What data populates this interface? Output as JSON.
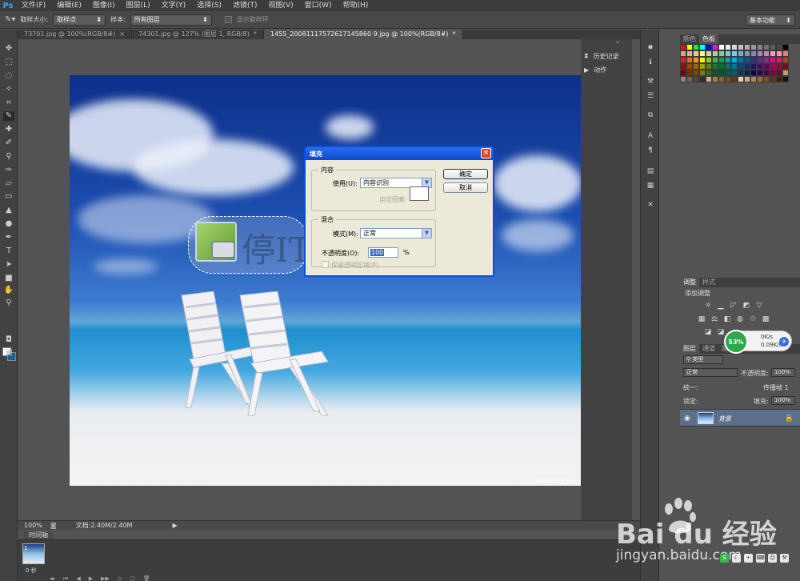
{
  "app": {
    "logo": "Ps"
  },
  "menu": [
    "文件(F)",
    "编辑(E)",
    "图像(I)",
    "图层(L)",
    "文字(Y)",
    "选择(S)",
    "滤镜(T)",
    "视图(V)",
    "窗口(W)",
    "帮助(H)"
  ],
  "options": {
    "sample_size_label": "取样大小:",
    "sample_size_value": "取样点",
    "sample_label": "样本:",
    "sample_value": "所有图层",
    "show_ring_label": "显示取样环",
    "workspace": "基本功能"
  },
  "doc_tabs": [
    {
      "label": "73701.jpg @ 100%(RGB/8#)",
      "close": "×",
      "active": false
    },
    {
      "label": "74301.jpg @ 127% (图层 1, RGB/8)",
      "close": "*",
      "active": false
    },
    {
      "label": "1455_20081117572617145860 9.jpg @ 100%(RGB/8#)",
      "close": "*",
      "active": true
    }
  ],
  "canvas": {
    "watermark_text": "停ITI",
    "credit": "www.fevte.com"
  },
  "status": {
    "zoom": "100%",
    "doc_size": "文档:2.40M/2.40M"
  },
  "timeline": {
    "tab": "时间轴",
    "frame_number": "1",
    "frame_time": "0 秒"
  },
  "history_panel": [
    {
      "icon": "history-icon",
      "label": "历史记录"
    },
    {
      "icon": "actions-icon",
      "label": "动作"
    }
  ],
  "color_panel": {
    "tabs": [
      "颜色",
      "色板"
    ],
    "active": 1
  },
  "swatch_colors": [
    "#ff0000",
    "#ffff00",
    "#00ff00",
    "#00ffff",
    "#0000ff",
    "#ff00ff",
    "#ffffff",
    "#ebebeb",
    "#d6d6d6",
    "#c2c2c2",
    "#adadad",
    "#999999",
    "#858585",
    "#707070",
    "#5c5c5c",
    "#474747",
    "#000000",
    "#f7977a",
    "#f9ad81",
    "#fdc68a",
    "#fff79a",
    "#c4df9b",
    "#a3d39c",
    "#82ca9d",
    "#7bcdc8",
    "#6ecff6",
    "#7ea7d8",
    "#8493ca",
    "#8882be",
    "#a187be",
    "#bc8dbf",
    "#f49ac2",
    "#f6989d",
    "#ff7777",
    "#ed1c24",
    "#f26522",
    "#f7941d",
    "#fff200",
    "#8dc63f",
    "#39b54a",
    "#00a651",
    "#00a99d",
    "#00aeef",
    "#0072bc",
    "#0054a6",
    "#2e3192",
    "#662d91",
    "#92278f",
    "#ec008c",
    "#ed145b",
    "#c0392b",
    "#9e0b0f",
    "#a0410d",
    "#a36209",
    "#aba000",
    "#598527",
    "#197b30",
    "#007236",
    "#00746b",
    "#0076a3",
    "#004a80",
    "#003471",
    "#1b1464",
    "#440e62",
    "#630460",
    "#9e005d",
    "#9e0039",
    "#7a0026",
    "#790000",
    "#7b2e00",
    "#7d4900",
    "#827b00",
    "#406618",
    "#005e20",
    "#005826",
    "#005952",
    "#005b7f",
    "#003663",
    "#002157",
    "#0d004c",
    "#32004b",
    "#4b0049",
    "#7b0046",
    "#7a0026",
    "#c69c6d",
    "#998675",
    "#736357",
    "#534741",
    "#362f2d",
    "#c7b299",
    "#a67c52",
    "#8c6239",
    "#754c24",
    "#603913",
    "#e8d2b1",
    "#d0ad7f",
    "#b8864a",
    "#9c6e3b",
    "#7a5128",
    "#593816",
    "#3a2208",
    "#1e1004"
  ],
  "adjust_panel": {
    "tabs": [
      "调整",
      "样式"
    ],
    "add_label": "添加调整"
  },
  "layers_panel": {
    "tabs": [
      "图层",
      "通道",
      "路径"
    ],
    "kind_label": "类型",
    "blend_mode": "正常",
    "opacity_label": "不透明度:",
    "opacity_value": "100%",
    "unify_label": "统一:",
    "propagate_label": "传播帧 1",
    "lock_label": "锁定:",
    "fill_label": "填充:",
    "fill_value": "100%",
    "layer_name": "背景"
  },
  "net_widget": {
    "percent": "53%",
    "up": "0K/s",
    "down": "0.09K/s"
  },
  "dialog": {
    "title": "填充",
    "content_group": "内容",
    "use_label": "使用(U):",
    "use_value": "内容识别",
    "custom_pattern_label": "自定图案:",
    "blend_group": "混合",
    "mode_label": "模式(M):",
    "mode_value": "正常",
    "opacity_label": "不透明度(O):",
    "opacity_value": "100",
    "percent": "%",
    "preserve_label": "保留透明区域(P)",
    "ok": "确定",
    "cancel": "取消"
  },
  "baidu": {
    "logo": "Bai du 经验",
    "url": "jingyan.baidu.com"
  }
}
